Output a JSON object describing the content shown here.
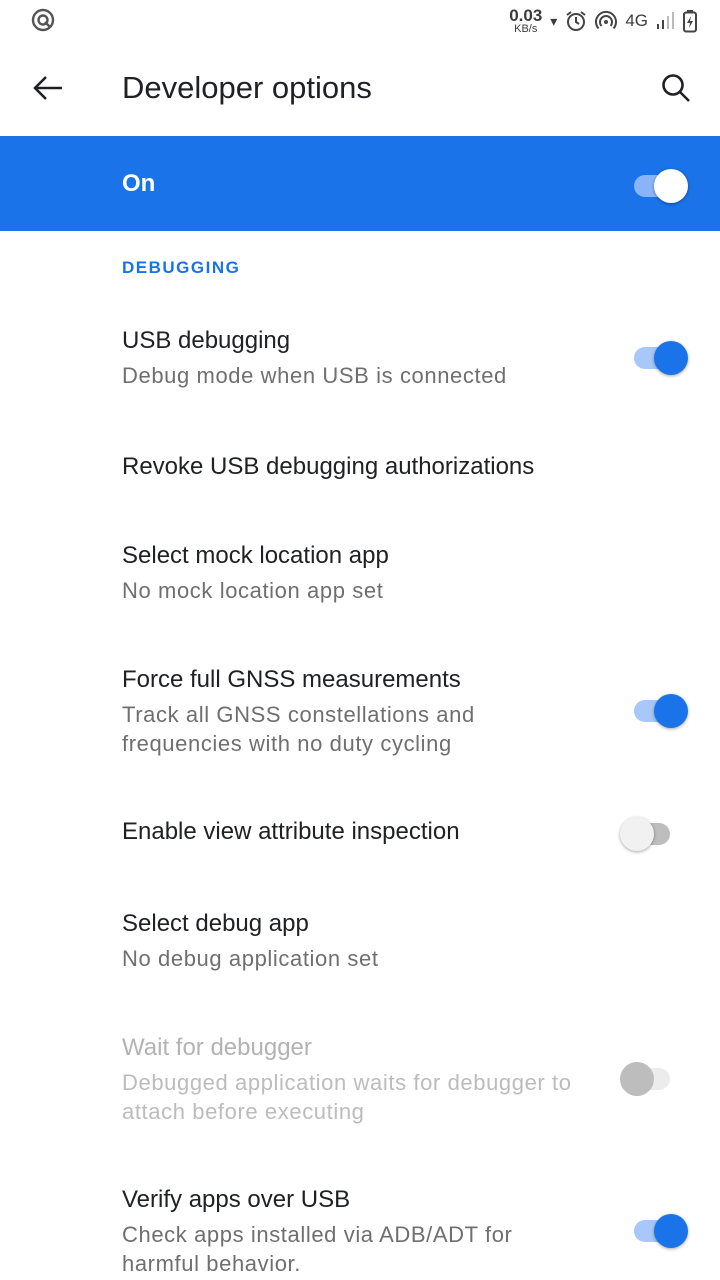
{
  "status_bar": {
    "net_speed_value": "0.03",
    "net_speed_unit": "KB/s",
    "network_type": "4G",
    "icons": [
      "app-notification-icon",
      "download-arrow-icon",
      "alarm-icon",
      "hotspot-icon",
      "signal-icon",
      "battery-charging-icon"
    ]
  },
  "app_bar": {
    "title": "Developer options",
    "back_icon": "arrow-left-icon",
    "search_icon": "search-icon"
  },
  "master_switch": {
    "label": "On",
    "checked": true
  },
  "section": {
    "header": "DEBUGGING"
  },
  "items": [
    {
      "title": "USB debugging",
      "summary": "Debug mode when USB is connected",
      "toggle": "on",
      "enabled": true
    },
    {
      "title": "Revoke USB debugging authorizations",
      "summary": "",
      "toggle": "none",
      "enabled": true
    },
    {
      "title": "Select mock location app",
      "summary": "No mock location app set",
      "toggle": "none",
      "enabled": true
    },
    {
      "title": "Force full GNSS measurements",
      "summary": "Track all GNSS constellations and frequencies with no duty cycling",
      "toggle": "on",
      "enabled": true
    },
    {
      "title": "Enable view attribute inspection",
      "summary": "",
      "toggle": "off",
      "enabled": true
    },
    {
      "title": "Select debug app",
      "summary": "No debug application set",
      "toggle": "none",
      "enabled": true
    },
    {
      "title": "Wait for debugger",
      "summary": "Debugged application waits for debugger to attach before executing",
      "toggle": "off",
      "enabled": false
    },
    {
      "title": "Verify apps over USB",
      "summary": "Check apps installed via ADB/ADT for harmful behavior.",
      "toggle": "on",
      "enabled": true
    }
  ],
  "colors": {
    "accent": "#1a73e8",
    "accent_light": "#a8c7fa",
    "text_primary": "#202124",
    "text_secondary": "#6f6f6f",
    "text_disabled": "#b3b3b3"
  }
}
